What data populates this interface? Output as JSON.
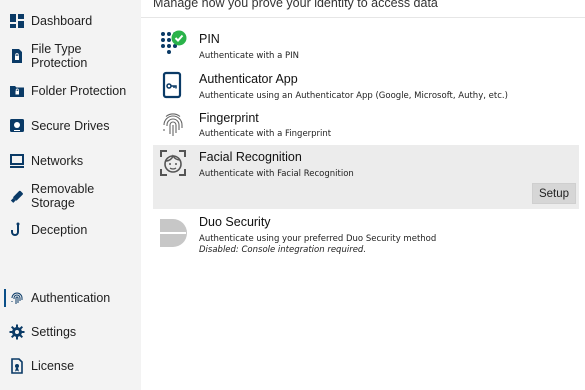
{
  "sidebar": {
    "items": [
      {
        "label": "Dashboard",
        "icon": "dashboard-icon"
      },
      {
        "label": "File Type Protection",
        "icon": "file-lock-icon"
      },
      {
        "label": "Folder Protection",
        "icon": "folder-lock-icon"
      },
      {
        "label": "Secure Drives",
        "icon": "secure-drive-icon"
      },
      {
        "label": "Networks",
        "icon": "network-monitor-icon"
      },
      {
        "label": "Removable Storage",
        "icon": "usb-icon"
      },
      {
        "label": "Deception",
        "icon": "hook-icon"
      },
      {
        "label": "Authentication",
        "icon": "fingerprint-icon",
        "active": true
      },
      {
        "label": "Settings",
        "icon": "gear-icon"
      },
      {
        "label": "License",
        "icon": "license-icon"
      }
    ]
  },
  "main": {
    "subtitle": "Manage how you prove your identity to access data",
    "methods": [
      {
        "title": "PIN",
        "description": "Authenticate with a PIN",
        "icon": "pin-keypad-icon",
        "status": "enabled"
      },
      {
        "title": "Authenticator App",
        "description": "Authenticate using an Authenticator App (Google, Microsoft, Authy, etc.)",
        "icon": "authenticator-app-icon"
      },
      {
        "title": "Fingerprint",
        "description": "Authenticate with a Fingerprint",
        "icon": "fingerprint-icon"
      },
      {
        "title": "Facial Recognition",
        "description": "Authenticate with Facial Recognition",
        "icon": "face-scan-icon",
        "selected": true,
        "action_label": "Setup"
      },
      {
        "title": "Duo Security",
        "description": "Authenticate using your preferred Duo Security method",
        "note": "Disabled: Console integration required.",
        "icon": "duo-logo-icon"
      }
    ]
  },
  "colors": {
    "sidebar_bg": "#f3f3f3",
    "icon_navy": "#0a3a66",
    "selected_row_bg": "#ececec",
    "check_green": "#2ab34a"
  }
}
